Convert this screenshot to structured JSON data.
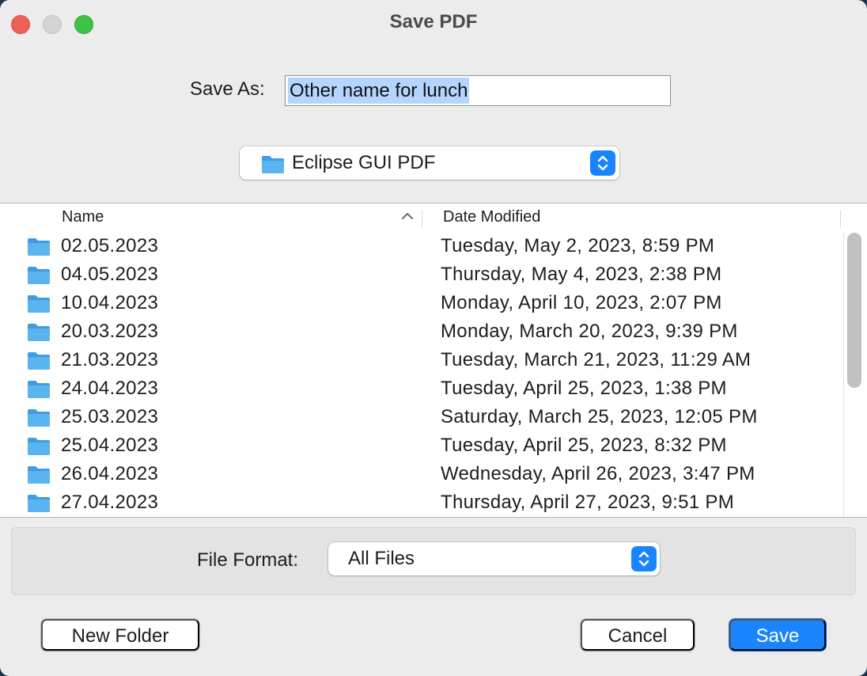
{
  "window": {
    "title": "Save PDF"
  },
  "save_as": {
    "label": "Save As:",
    "value": "Other name for lunch"
  },
  "location": {
    "icon": "folder-icon",
    "label": "Eclipse GUI PDF"
  },
  "file_list": {
    "columns": {
      "name": "Name",
      "date_modified": "Date Modified"
    },
    "sort": "name-ascending",
    "rows": [
      {
        "name": "02.05.2023",
        "date": "Tuesday, May 2, 2023, 8:59 PM"
      },
      {
        "name": "04.05.2023",
        "date": "Thursday, May 4, 2023, 2:38 PM"
      },
      {
        "name": "10.04.2023",
        "date": "Monday, April 10, 2023, 2:07 PM"
      },
      {
        "name": "20.03.2023",
        "date": "Monday, March 20, 2023, 9:39 PM"
      },
      {
        "name": "21.03.2023",
        "date": "Tuesday, March 21, 2023, 11:29 AM"
      },
      {
        "name": "24.04.2023",
        "date": "Tuesday, April 25, 2023, 1:38 PM"
      },
      {
        "name": "25.03.2023",
        "date": "Saturday, March 25, 2023, 12:05 PM"
      },
      {
        "name": "25.04.2023",
        "date": "Tuesday, April 25, 2023, 8:32 PM"
      },
      {
        "name": "26.04.2023",
        "date": "Wednesday, April 26, 2023, 3:47 PM"
      },
      {
        "name": "27.04.2023",
        "date": "Thursday, April 27, 2023, 9:51 PM"
      }
    ]
  },
  "file_format": {
    "label": "File Format:",
    "value": "All Files"
  },
  "buttons": {
    "new_folder": "New Folder",
    "cancel": "Cancel",
    "save": "Save"
  },
  "colors": {
    "accent": "#1a84ff",
    "folder": "#5ab4ee",
    "selection": "#b4d5fe"
  }
}
